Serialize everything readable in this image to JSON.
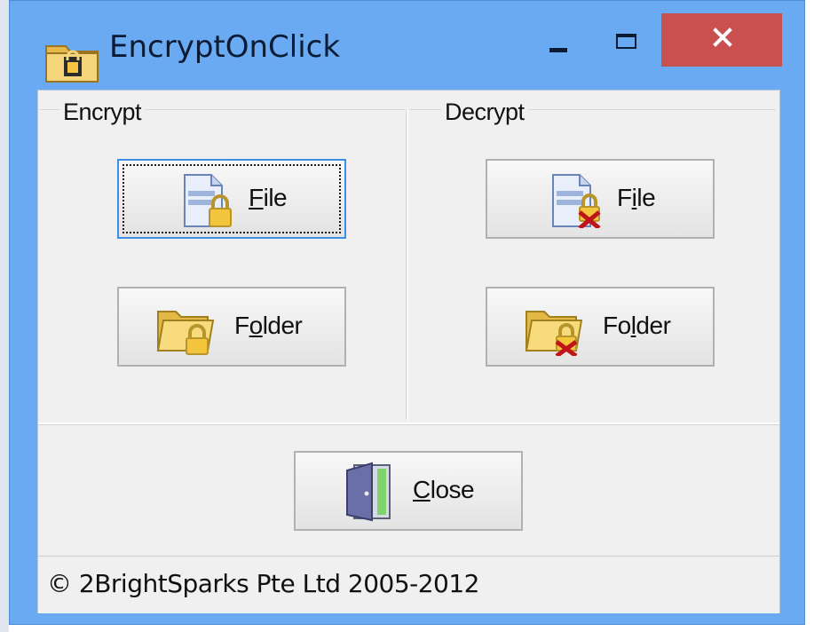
{
  "window": {
    "title": "EncryptOnClick",
    "app_icon": "lock-folder-icon",
    "controls": {
      "minimize_icon": "minimize-icon",
      "maximize_icon": "maximize-icon",
      "close_icon": "close-icon"
    }
  },
  "encrypt": {
    "group_label": "Encrypt",
    "file_button": {
      "label_mnemonic": "F",
      "label_rest": "ile",
      "icon": "file-lock-icon"
    },
    "folder_button": {
      "label_before": "F",
      "label_mnemonic": "o",
      "label_rest": "lder",
      "icon": "folder-lock-icon"
    }
  },
  "decrypt": {
    "group_label": "Decrypt",
    "file_button": {
      "label_before": "F",
      "label_mnemonic": "i",
      "label_rest": "le",
      "icon": "file-unlock-icon"
    },
    "folder_button": {
      "label_before": "Fo",
      "label_mnemonic": "l",
      "label_rest": "der",
      "icon": "folder-unlock-icon"
    }
  },
  "close_button": {
    "label_mnemonic": "C",
    "label_rest": "lose",
    "icon": "door-exit-icon"
  },
  "status": {
    "text": "© 2BrightSparks Pte Ltd 2005-2012"
  },
  "colors": {
    "titlebar": "#6aaaf2",
    "close_button": "#c9504f",
    "client_bg": "#f0f0f0",
    "focus_border": "#3c8fe3"
  }
}
